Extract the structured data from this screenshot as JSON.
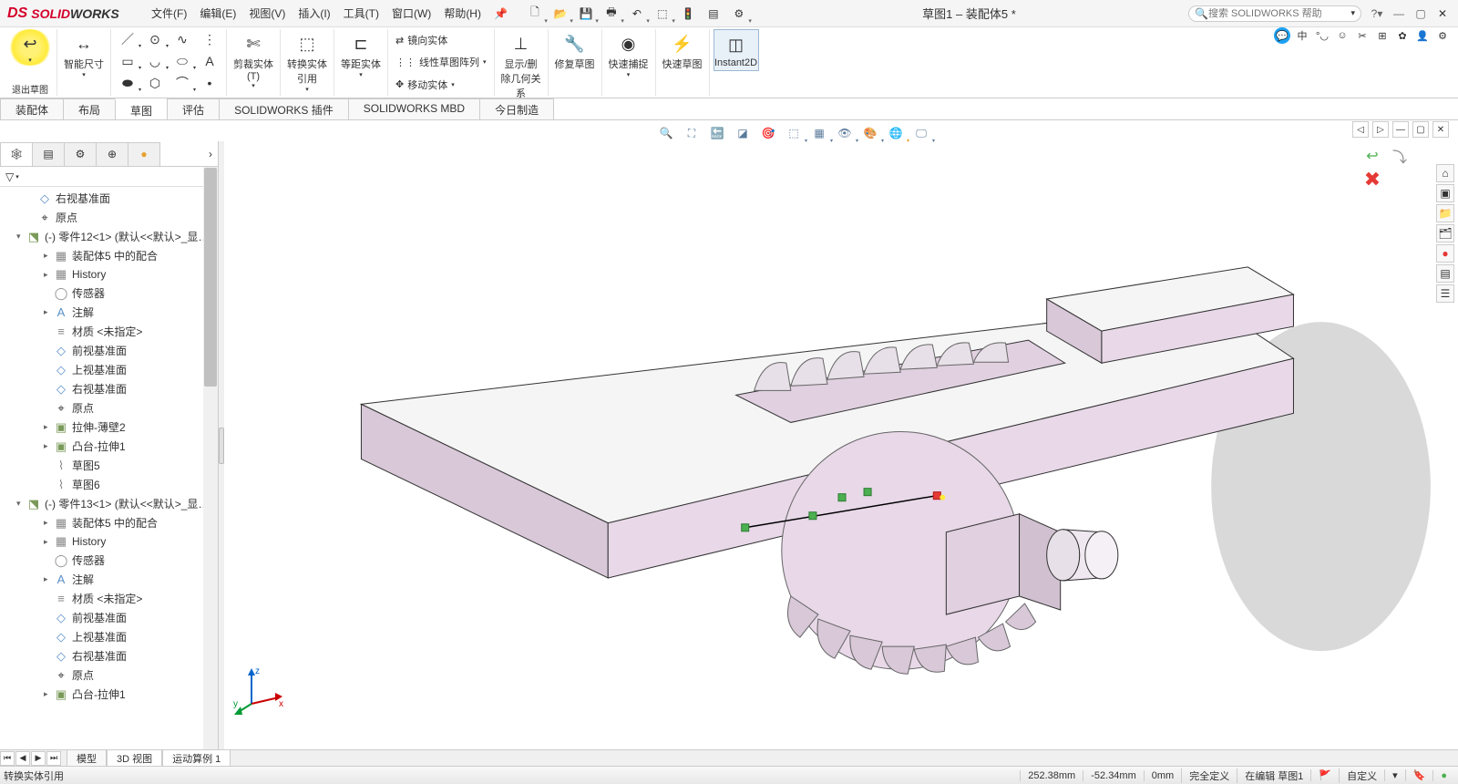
{
  "logo": {
    "ds": "DS",
    "solid": "SOLID",
    "works": "WORKS"
  },
  "menu": [
    "文件(F)",
    "编辑(E)",
    "视图(V)",
    "插入(I)",
    "工具(T)",
    "窗口(W)",
    "帮助(H)"
  ],
  "title_doc": "草图1 – 装配体5 *",
  "search_placeholder": "搜索 SOLIDWORKS 帮助",
  "ribbon": {
    "exit_sketch": "退出草图",
    "smart_dim": "智能尺寸",
    "trim": "剪裁实体(T)",
    "convert": "转换实体引用",
    "offset": "等距实体",
    "mirror": "镜向实体",
    "linear_pattern": "线性草图阵列",
    "move": "移动实体",
    "display_delete": "显示/删除几何关系",
    "repair": "修复草图",
    "quick_snap": "快速捕捉",
    "rapid": "快速草图",
    "instant": "Instant2D"
  },
  "ribbon_tabs": [
    "装配体",
    "布局",
    "草图",
    "评估",
    "SOLIDWORKS 插件",
    "SOLIDWORKS MBD",
    "今日制造"
  ],
  "tree": [
    {
      "ind": 1,
      "ico": "◇",
      "txt": "右视基准面",
      "color": "#5a8fc7"
    },
    {
      "ind": 1,
      "ico": "⌖",
      "txt": "原点",
      "color": "#333"
    },
    {
      "ind": 0,
      "exp": "▾",
      "ico": "⬔",
      "txt": "(-) 零件12<1> (默认<<默认>_显…",
      "color": "#7a9a5a"
    },
    {
      "ind": 2,
      "exp": "▸",
      "ico": "▦",
      "txt": "装配体5 中的配合",
      "color": "#888"
    },
    {
      "ind": 2,
      "exp": "▸",
      "ico": "▦",
      "txt": "History",
      "color": "#888"
    },
    {
      "ind": 2,
      "ico": "◯",
      "txt": "传感器",
      "color": "#888"
    },
    {
      "ind": 2,
      "exp": "▸",
      "ico": "A",
      "txt": "注解",
      "color": "#5a8fc7"
    },
    {
      "ind": 2,
      "ico": "≡",
      "txt": "材质 <未指定>",
      "color": "#888"
    },
    {
      "ind": 2,
      "ico": "◇",
      "txt": "前视基准面",
      "color": "#5a8fc7"
    },
    {
      "ind": 2,
      "ico": "◇",
      "txt": "上视基准面",
      "color": "#5a8fc7"
    },
    {
      "ind": 2,
      "ico": "◇",
      "txt": "右视基准面",
      "color": "#5a8fc7"
    },
    {
      "ind": 2,
      "ico": "⌖",
      "txt": "原点",
      "color": "#333"
    },
    {
      "ind": 2,
      "exp": "▸",
      "ico": "▣",
      "txt": "拉伸-薄壁2",
      "color": "#7a9a5a"
    },
    {
      "ind": 2,
      "exp": "▸",
      "ico": "▣",
      "txt": "凸台-拉伸1",
      "color": "#7a9a5a"
    },
    {
      "ind": 2,
      "ico": "⌇",
      "txt": "草图5",
      "color": "#888"
    },
    {
      "ind": 2,
      "ico": "⌇",
      "txt": "草图6",
      "color": "#888"
    },
    {
      "ind": 0,
      "exp": "▾",
      "ico": "⬔",
      "txt": "(-) 零件13<1> (默认<<默认>_显…",
      "color": "#7a9a5a"
    },
    {
      "ind": 2,
      "exp": "▸",
      "ico": "▦",
      "txt": "装配体5 中的配合",
      "color": "#888"
    },
    {
      "ind": 2,
      "exp": "▸",
      "ico": "▦",
      "txt": "History",
      "color": "#888"
    },
    {
      "ind": 2,
      "ico": "◯",
      "txt": "传感器",
      "color": "#888"
    },
    {
      "ind": 2,
      "exp": "▸",
      "ico": "A",
      "txt": "注解",
      "color": "#5a8fc7"
    },
    {
      "ind": 2,
      "ico": "≡",
      "txt": "材质 <未指定>",
      "color": "#888"
    },
    {
      "ind": 2,
      "ico": "◇",
      "txt": "前视基准面",
      "color": "#5a8fc7"
    },
    {
      "ind": 2,
      "ico": "◇",
      "txt": "上视基准面",
      "color": "#5a8fc7"
    },
    {
      "ind": 2,
      "ico": "◇",
      "txt": "右视基准面",
      "color": "#5a8fc7"
    },
    {
      "ind": 2,
      "ico": "⌖",
      "txt": "原点",
      "color": "#333"
    },
    {
      "ind": 2,
      "exp": "▸",
      "ico": "▣",
      "txt": "凸台-拉伸1",
      "color": "#7a9a5a"
    }
  ],
  "bottom_tabs": [
    "模型",
    "3D 视图",
    "运动算例 1"
  ],
  "status": {
    "hint": "转换实体引用",
    "coord_x": "252.38mm",
    "coord_y": "-52.34mm",
    "coord_z": "0mm",
    "def": "完全定义",
    "edit": "在编辑 草图1",
    "custom": "自定义"
  },
  "triad_labels": {
    "x": "x",
    "y": "y",
    "z": "z"
  }
}
